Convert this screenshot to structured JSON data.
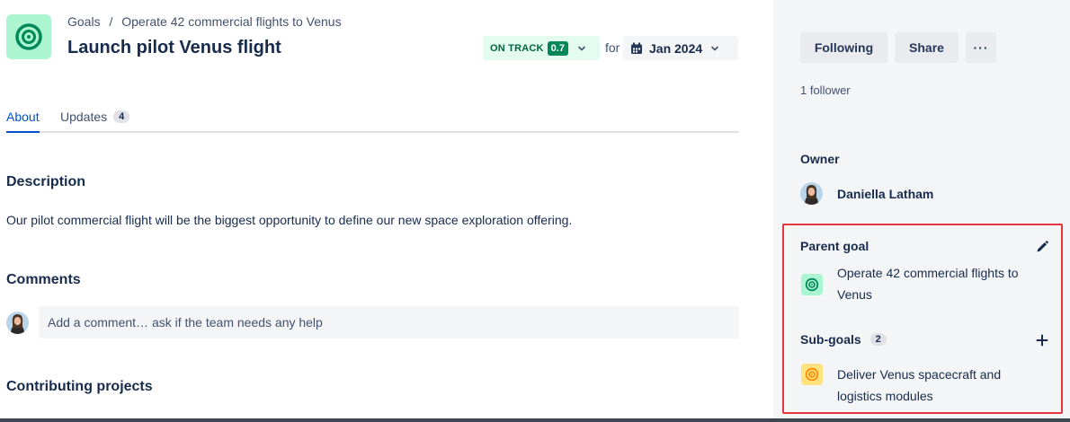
{
  "breadcrumb": {
    "root": "Goals",
    "separator": "/",
    "parent": "Operate 42 commercial flights to Venus"
  },
  "header": {
    "title": "Launch pilot Venus flight",
    "status_label": "ON TRACK",
    "score": "0.7",
    "for_text": "for",
    "target_date": "Jan 2024"
  },
  "tabs": {
    "about": "About",
    "updates": "Updates",
    "updates_count": "4"
  },
  "description": {
    "heading": "Description",
    "text": "Our pilot commercial flight will be the biggest opportunity to define our new space exploration offering."
  },
  "comments": {
    "heading": "Comments",
    "placeholder": "Add a comment… ask if the team needs any help"
  },
  "contributing": {
    "heading": "Contributing projects"
  },
  "sidebar": {
    "following_label": "Following",
    "share_label": "Share",
    "more_label": "···",
    "followers": "1 follower",
    "owner_heading": "Owner",
    "owner_name": "Daniella Latham",
    "parent_heading": "Parent goal",
    "parent_goal_line1": "Operate 42 commercial flights to",
    "parent_goal_line2": "Venus",
    "subgoals_heading": "Sub-goals",
    "subgoals_count": "2",
    "subgoal_line1": "Deliver Venus spacecraft and",
    "subgoal_line2": "logistics modules"
  },
  "colors": {
    "goal_green": "#00875a",
    "goal_green_bg": "#abf5d1",
    "goal_yellow": "#ff8b00",
    "goal_yellow_bg": "#ffe380",
    "highlight_red": "#e5363f",
    "link_blue": "#0052cc"
  },
  "icons": {
    "goal": "target-icon",
    "status_dropdown": "chevron-down-icon",
    "date": "calendar-icon",
    "edit": "pencil-icon",
    "add": "plus-icon"
  }
}
